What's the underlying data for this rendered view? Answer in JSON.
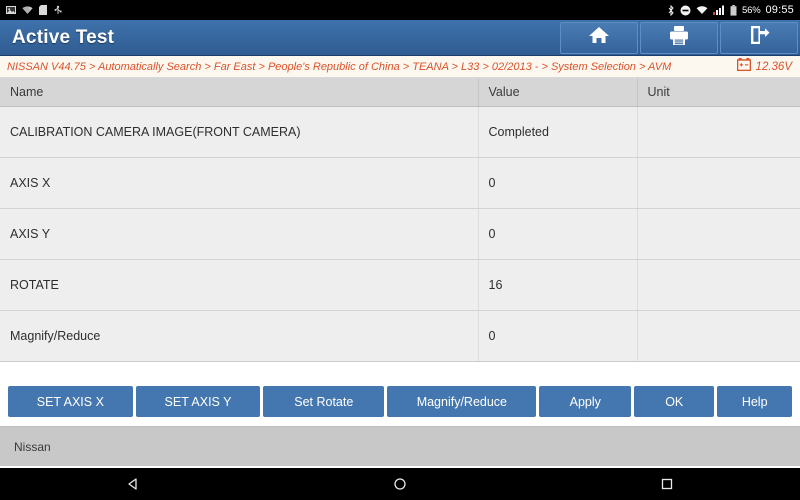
{
  "status_bar": {
    "left_icons": [
      "screenshot-icon",
      "wifi-question-icon",
      "sdcard-icon",
      "usb-icon"
    ],
    "right_icons": [
      "bluetooth-icon",
      "mute-icon",
      "wifi-icon",
      "signal-icon",
      "battery-icon"
    ],
    "battery_percent": "56%",
    "clock": "09:55"
  },
  "header": {
    "title": "Active Test",
    "actions": [
      {
        "name": "home-button",
        "icon": "home-icon"
      },
      {
        "name": "print-button",
        "icon": "printer-icon"
      },
      {
        "name": "exit-button",
        "icon": "exit-icon"
      }
    ]
  },
  "breadcrumb": {
    "path": "NISSAN V44.75 > Automatically Search > Far East > People's Republic of China > TEANA > L33 > 02/2013 - > System Selection > AVM",
    "voltage": "12.36V",
    "voltage_icon": "car-battery-icon"
  },
  "table": {
    "columns": [
      "Name",
      "Value",
      "Unit"
    ],
    "rows": [
      {
        "name": "CALIBRATION CAMERA IMAGE(FRONT CAMERA)",
        "value": "Completed",
        "unit": ""
      },
      {
        "name": "AXIS X",
        "value": "0",
        "unit": ""
      },
      {
        "name": "AXIS Y",
        "value": "0",
        "unit": ""
      },
      {
        "name": "ROTATE",
        "value": "16",
        "unit": ""
      },
      {
        "name": "Magnify/Reduce",
        "value": "0",
        "unit": ""
      }
    ]
  },
  "buttons": [
    {
      "label": "SET AXIS X",
      "name": "set-axis-x-button",
      "flex": 132
    },
    {
      "label": "SET AXIS Y",
      "name": "set-axis-y-button",
      "flex": 132
    },
    {
      "label": "Set Rotate",
      "name": "set-rotate-button",
      "flex": 128
    },
    {
      "label": "Magnify/Reduce",
      "name": "magnify-reduce-button",
      "flex": 158
    },
    {
      "label": "Apply",
      "name": "apply-button",
      "flex": 97
    },
    {
      "label": "OK",
      "name": "ok-button",
      "flex": 85
    },
    {
      "label": "Help",
      "name": "help-button",
      "flex": 79
    }
  ],
  "footer": {
    "text": "Nissan"
  },
  "navbar": {
    "items": [
      {
        "name": "nav-back-button",
        "icon": "triangle-back-icon"
      },
      {
        "name": "nav-home-button",
        "icon": "circle-home-icon"
      },
      {
        "name": "nav-recents-button",
        "icon": "square-recents-icon"
      }
    ]
  },
  "colors": {
    "title_blue": "#3f72ab",
    "button_blue": "#4477b0",
    "breadcrumb_orange": "#d9532c",
    "breadcrumb_bg": "#fdf8ef",
    "table_header_gray": "#d6d6d6",
    "table_row_gray": "#eeeeee",
    "footer_gray": "#c8c8c8"
  }
}
